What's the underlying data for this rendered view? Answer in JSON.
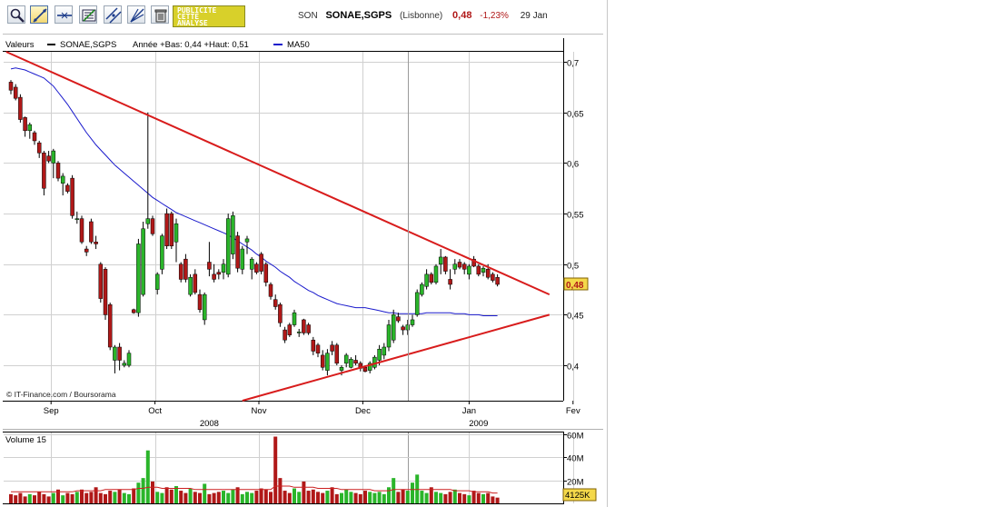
{
  "toolbar": {
    "tools": [
      {
        "name": "zoom-icon"
      },
      {
        "name": "trendline-icon"
      },
      {
        "name": "horizontal-line-icon"
      },
      {
        "name": "indicator-icon"
      },
      {
        "name": "parallel-line-icon"
      },
      {
        "name": "fan-lines-icon"
      },
      {
        "name": "delete-icon"
      }
    ],
    "ad_lines": [
      "PUBLICITE",
      "CETTE",
      "ANALYSE"
    ]
  },
  "quote": {
    "symbol": "SON",
    "name": "SONAE,SGPS",
    "exchange": "(Lisbonne)",
    "price": "0,48",
    "change": "-1,23%",
    "date": "29 Jan"
  },
  "colors": {
    "up": "#2ab52a",
    "down": "#b01818",
    "ma": "#1a1acc",
    "trendline": "#d81c1c",
    "grid": "#d0d0d0",
    "cursor": "#9a9a9a"
  },
  "chart_data": [
    {
      "type": "candlestick",
      "legend": {
        "prefix": "Valeurs",
        "series_label": "SONAE,SGPS",
        "stats": "Année +Bas: 0,44 +Haut: 0,51",
        "ma_label": "MA50"
      },
      "copyright": "© IT-Finance.com / Boursorama",
      "ylim": [
        0.365,
        0.71
      ],
      "y_ticks": [
        "0,7",
        "0,65",
        "0,6",
        "0,55",
        "0,5",
        "0,45",
        "0,4"
      ],
      "y_tick_values": [
        0.7,
        0.65,
        0.6,
        0.55,
        0.5,
        0.45,
        0.4
      ],
      "x_month_ticks": [
        "Sep",
        "Oct",
        "Nov",
        "Dec",
        "Jan",
        "Fev"
      ],
      "x_month_index": [
        8.5,
        30.5,
        52.5,
        74.5,
        97,
        119
      ],
      "x_year_ticks": [
        "2008",
        "2009"
      ],
      "x_year_index": [
        42,
        99
      ],
      "grid": true,
      "last_price_label": "0,48",
      "last_price": 0.48,
      "cursor_index": 84,
      "ohlc": [
        [
          0.68,
          0.682,
          0.668,
          0.672
        ],
        [
          0.675,
          0.678,
          0.662,
          0.664
        ],
        [
          0.665,
          0.668,
          0.64,
          0.643
        ],
        [
          0.645,
          0.646,
          0.626,
          0.632
        ],
        [
          0.632,
          0.64,
          0.624,
          0.638
        ],
        [
          0.63,
          0.632,
          0.618,
          0.622
        ],
        [
          0.62,
          0.622,
          0.605,
          0.61
        ],
        [
          0.61,
          0.612,
          0.568,
          0.575
        ],
        [
          0.607,
          0.612,
          0.6,
          0.602
        ],
        [
          0.6,
          0.614,
          0.585,
          0.612
        ],
        [
          0.6,
          0.602,
          0.582,
          0.585
        ],
        [
          0.58,
          0.59,
          0.568,
          0.587
        ],
        [
          0.578,
          0.58,
          0.57,
          0.572
        ],
        [
          0.585,
          0.588,
          0.545,
          0.548
        ],
        [
          0.545,
          0.552,
          0.54,
          0.545
        ],
        [
          0.545,
          0.548,
          0.52,
          0.522
        ],
        [
          0.515,
          0.518,
          0.508,
          0.512
        ],
        [
          0.542,
          0.545,
          0.52,
          0.522
        ],
        [
          0.522,
          0.528,
          0.515,
          0.52
        ],
        [
          0.5,
          0.502,
          0.462,
          0.466
        ],
        [
          0.495,
          0.497,
          0.445,
          0.45
        ],
        [
          0.46,
          0.462,
          0.415,
          0.418
        ],
        [
          0.405,
          0.42,
          0.392,
          0.418
        ],
        [
          0.418,
          0.422,
          0.395,
          0.405
        ],
        [
          0.4,
          0.405,
          0.398,
          0.402
        ],
        [
          0.4,
          0.415,
          0.398,
          0.412
        ],
        [
          0.455,
          0.456,
          0.451,
          0.452
        ],
        [
          0.452,
          0.525,
          0.448,
          0.52
        ],
        [
          0.47,
          0.542,
          0.468,
          0.535
        ],
        [
          0.54,
          0.65,
          0.535,
          0.545
        ],
        [
          0.545,
          0.548,
          0.528,
          0.53
        ],
        [
          0.475,
          0.492,
          0.47,
          0.49
        ],
        [
          0.495,
          0.53,
          0.49,
          0.528
        ],
        [
          0.55,
          0.555,
          0.515,
          0.518
        ],
        [
          0.55,
          0.552,
          0.515,
          0.518
        ],
        [
          0.522,
          0.545,
          0.502,
          0.54
        ],
        [
          0.5,
          0.502,
          0.482,
          0.485
        ],
        [
          0.505,
          0.51,
          0.482,
          0.485
        ],
        [
          0.47,
          0.49,
          0.468,
          0.487
        ],
        [
          0.49,
          0.495,
          0.47,
          0.472
        ],
        [
          0.47,
          0.475,
          0.452,
          0.455
        ],
        [
          0.445,
          0.472,
          0.44,
          0.47
        ],
        [
          0.502,
          0.522,
          0.488,
          0.495
        ],
        [
          0.49,
          0.5,
          0.482,
          0.485
        ],
        [
          0.492,
          0.495,
          0.485,
          0.49
        ],
        [
          0.492,
          0.505,
          0.485,
          0.5
        ],
        [
          0.49,
          0.55,
          0.487,
          0.545
        ],
        [
          0.51,
          0.552,
          0.505,
          0.548
        ],
        [
          0.528,
          0.532,
          0.492,
          0.496
        ],
        [
          0.495,
          0.518,
          0.49,
          0.515
        ],
        [
          0.522,
          0.528,
          0.51,
          0.525
        ],
        [
          0.495,
          0.507,
          0.485,
          0.505
        ],
        [
          0.5,
          0.502,
          0.49,
          0.492
        ],
        [
          0.51,
          0.512,
          0.49,
          0.493
        ],
        [
          0.5,
          0.502,
          0.478,
          0.482
        ],
        [
          0.48,
          0.482,
          0.465,
          0.468
        ],
        [
          0.465,
          0.47,
          0.455,
          0.458
        ],
        [
          0.46,
          0.462,
          0.438,
          0.442
        ],
        [
          0.435,
          0.438,
          0.422,
          0.425
        ],
        [
          0.44,
          0.442,
          0.428,
          0.43
        ],
        [
          0.44,
          0.455,
          0.438,
          0.452
        ],
        [
          0.432,
          0.436,
          0.428,
          0.433
        ],
        [
          0.445,
          0.446,
          0.43,
          0.432
        ],
        [
          0.44,
          0.442,
          0.43,
          0.432
        ],
        [
          0.425,
          0.428,
          0.41,
          0.414
        ],
        [
          0.42,
          0.422,
          0.408,
          0.412
        ],
        [
          0.41,
          0.415,
          0.395,
          0.398
        ],
        [
          0.395,
          0.416,
          0.39,
          0.412
        ],
        [
          0.42,
          0.424,
          0.41,
          0.414
        ],
        [
          0.42,
          0.422,
          0.4,
          0.402
        ],
        [
          0.395,
          0.4,
          0.39,
          0.398
        ],
        [
          0.402,
          0.412,
          0.398,
          0.41
        ],
        [
          0.398,
          0.408,
          0.397,
          0.406
        ],
        [
          0.405,
          0.41,
          0.4,
          0.402
        ],
        [
          0.402,
          0.404,
          0.394,
          0.397
        ],
        [
          0.398,
          0.4,
          0.393,
          0.394
        ],
        [
          0.395,
          0.404,
          0.392,
          0.402
        ],
        [
          0.398,
          0.41,
          0.396,
          0.408
        ],
        [
          0.405,
          0.42,
          0.4,
          0.416
        ],
        [
          0.41,
          0.422,
          0.406,
          0.418
        ],
        [
          0.418,
          0.445,
          0.414,
          0.44
        ],
        [
          0.425,
          0.455,
          0.422,
          0.45
        ],
        [
          0.448,
          0.452,
          0.442,
          0.444
        ],
        [
          0.438,
          0.44,
          0.43,
          0.435
        ],
        [
          0.435,
          0.445,
          0.43,
          0.44
        ],
        [
          0.44,
          0.45,
          0.438,
          0.445
        ],
        [
          0.45,
          0.475,
          0.448,
          0.472
        ],
        [
          0.47,
          0.482,
          0.468,
          0.48
        ],
        [
          0.478,
          0.495,
          0.475,
          0.49
        ],
        [
          0.49,
          0.492,
          0.48,
          0.482
        ],
        [
          0.482,
          0.5,
          0.48,
          0.498
        ],
        [
          0.5,
          0.515,
          0.49,
          0.507
        ],
        [
          0.507,
          0.508,
          0.49,
          0.493
        ],
        [
          0.485,
          0.495,
          0.475,
          0.48
        ],
        [
          0.495,
          0.505,
          0.49,
          0.5
        ],
        [
          0.502,
          0.505,
          0.495,
          0.497
        ],
        [
          0.5,
          0.502,
          0.49,
          0.495
        ],
        [
          0.49,
          0.5,
          0.485,
          0.498
        ],
        [
          0.505,
          0.508,
          0.497,
          0.498
        ],
        [
          0.498,
          0.5,
          0.488,
          0.49
        ],
        [
          0.492,
          0.498,
          0.488,
          0.496
        ],
        [
          0.495,
          0.5,
          0.485,
          0.487
        ],
        [
          0.49,
          0.492,
          0.482,
          0.484
        ],
        [
          0.487,
          0.49,
          0.478,
          0.48
        ]
      ],
      "ma50": [
        0.693,
        0.694,
        0.693,
        0.692,
        0.69,
        0.688,
        0.686,
        0.684,
        0.68,
        0.676,
        0.67,
        0.664,
        0.658,
        0.651,
        0.644,
        0.637,
        0.63,
        0.624,
        0.618,
        0.613,
        0.608,
        0.603,
        0.598,
        0.594,
        0.59,
        0.586,
        0.582,
        0.578,
        0.574,
        0.57,
        0.566,
        0.563,
        0.56,
        0.557,
        0.554,
        0.551,
        0.549,
        0.547,
        0.545,
        0.543,
        0.541,
        0.539,
        0.537,
        0.535,
        0.533,
        0.531,
        0.529,
        0.526,
        0.523,
        0.52,
        0.517,
        0.514,
        0.51,
        0.507,
        0.503,
        0.5,
        0.497,
        0.493,
        0.49,
        0.487,
        0.483,
        0.48,
        0.477,
        0.474,
        0.472,
        0.469,
        0.467,
        0.465,
        0.463,
        0.461,
        0.46,
        0.459,
        0.458,
        0.457,
        0.457,
        0.457,
        0.456,
        0.455,
        0.454,
        0.453,
        0.452,
        0.452,
        0.451,
        0.451,
        0.451,
        0.451,
        0.451,
        0.451,
        0.452,
        0.452,
        0.452,
        0.452,
        0.452,
        0.452,
        0.451,
        0.451,
        0.451,
        0.45,
        0.45,
        0.45,
        0.449,
        0.449,
        0.449,
        0.449
      ],
      "trendlines": [
        {
          "from": [
            -1,
            0.71
          ],
          "to": [
            114,
            0.47
          ]
        },
        {
          "from": [
            49,
            0.365
          ],
          "to": [
            114,
            0.45
          ]
        }
      ]
    },
    {
      "type": "bar",
      "title": "Volume 15",
      "unit": "M",
      "ylim": [
        0,
        60
      ],
      "y_ticks": [
        "60M",
        "40M",
        "20M"
      ],
      "y_tick_values": [
        60,
        40,
        20
      ],
      "last_value_label": "4125K",
      "ma_color": "#cc2020",
      "values": [
        8,
        7,
        9,
        6,
        8,
        7,
        10,
        8,
        6,
        9,
        12,
        7,
        9,
        8,
        10,
        12,
        9,
        10,
        14,
        9,
        8,
        11,
        10,
        12,
        9,
        8,
        13,
        18,
        22,
        46,
        19,
        10,
        9,
        14,
        12,
        15,
        11,
        9,
        13,
        10,
        9,
        17,
        8,
        9,
        10,
        11,
        9,
        12,
        14,
        8,
        10,
        9,
        11,
        13,
        12,
        10,
        58,
        22,
        11,
        9,
        13,
        10,
        19,
        11,
        12,
        10,
        9,
        11,
        14,
        8,
        9,
        12,
        10,
        9,
        8,
        11,
        10,
        9,
        10,
        8,
        14,
        22,
        10,
        12,
        11,
        18,
        25,
        11,
        9,
        14,
        10,
        9,
        8,
        10,
        12,
        9,
        8,
        7,
        11,
        9,
        8,
        9,
        6,
        5
      ],
      "ma": [
        10,
        10,
        10,
        10,
        10,
        10,
        10,
        10,
        10,
        10,
        10,
        10,
        10,
        10,
        11,
        11,
        11,
        11,
        11,
        11,
        12,
        12,
        12,
        12,
        12,
        12,
        12,
        13,
        13,
        14,
        14,
        14,
        13,
        13,
        13,
        13,
        13,
        13,
        13,
        12,
        12,
        12,
        12,
        12,
        12,
        12,
        12,
        12,
        12,
        12,
        12,
        12,
        12,
        12,
        12,
        12,
        15,
        15,
        15,
        15,
        14,
        14,
        14,
        14,
        14,
        13,
        13,
        13,
        13,
        13,
        12,
        12,
        12,
        12,
        12,
        12,
        12,
        11,
        11,
        11,
        11,
        12,
        12,
        12,
        12,
        12,
        12,
        12,
        12,
        12,
        12,
        12,
        12,
        12,
        11,
        11,
        11,
        11,
        10,
        10,
        10,
        10,
        9,
        9
      ]
    }
  ]
}
